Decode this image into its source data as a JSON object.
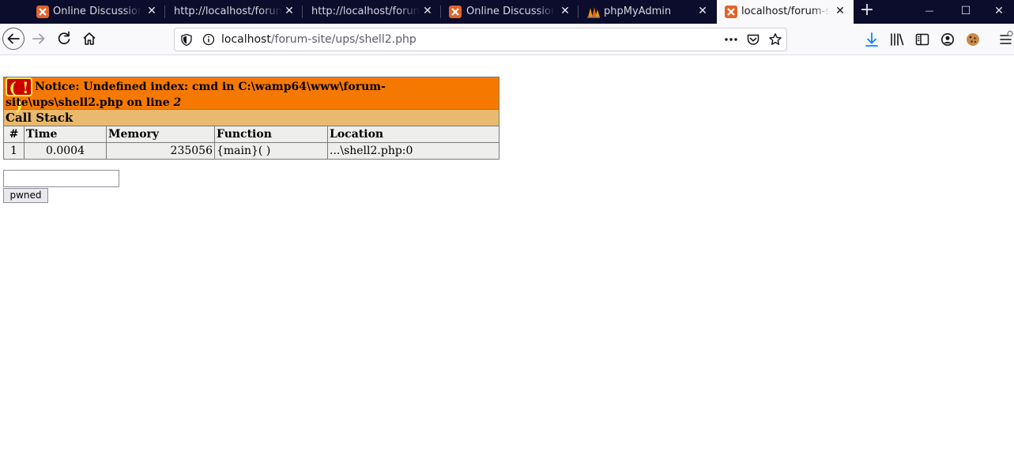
{
  "browser": {
    "tabs": [
      {
        "title": "Online Discussion Forum",
        "icon": "xampp-icon",
        "active": false
      },
      {
        "title": "http://localhost/forum-site/",
        "icon": "",
        "active": false
      },
      {
        "title": "http://localhost/forum-site/",
        "icon": "",
        "active": false
      },
      {
        "title": "Online Discussion Forum",
        "icon": "xampp-icon",
        "active": false
      },
      {
        "title": "phpMyAdmin",
        "icon": "phpmyadmin-icon",
        "active": false
      },
      {
        "title": "localhost/forum-site/ups/shell2.php",
        "icon": "xampp-icon",
        "active": true
      }
    ],
    "new_tab": "+",
    "window_controls": {
      "minimize": "—",
      "maximize": "☐",
      "close": "✕"
    },
    "url_host": "localhost",
    "url_path": "/forum-site/ups/shell2.php",
    "colors": {
      "tabstrip": "#0c0c2c",
      "download_accent": "#0a84ff"
    }
  },
  "xdebug": {
    "badge": "( ! )",
    "notice_text": "Notice: Undefined index: cmd in C:\\wamp64\\www\\forum-site\\ups\\shell2.php on line ",
    "notice_line": "2",
    "call_stack_title": "Call Stack",
    "columns": [
      "#",
      "Time",
      "Memory",
      "Function",
      "Location"
    ],
    "rows": [
      {
        "num": "1",
        "time": "0.0004",
        "memory": "235056",
        "function": "{main}( )",
        "location": "...\\shell2.php:0"
      }
    ],
    "colors": {
      "notice_bg": "#f57900",
      "callstack_bg": "#e9b96e",
      "cell_bg": "#eeeeec"
    }
  },
  "form": {
    "input_value": "",
    "button_label": "pwned"
  }
}
